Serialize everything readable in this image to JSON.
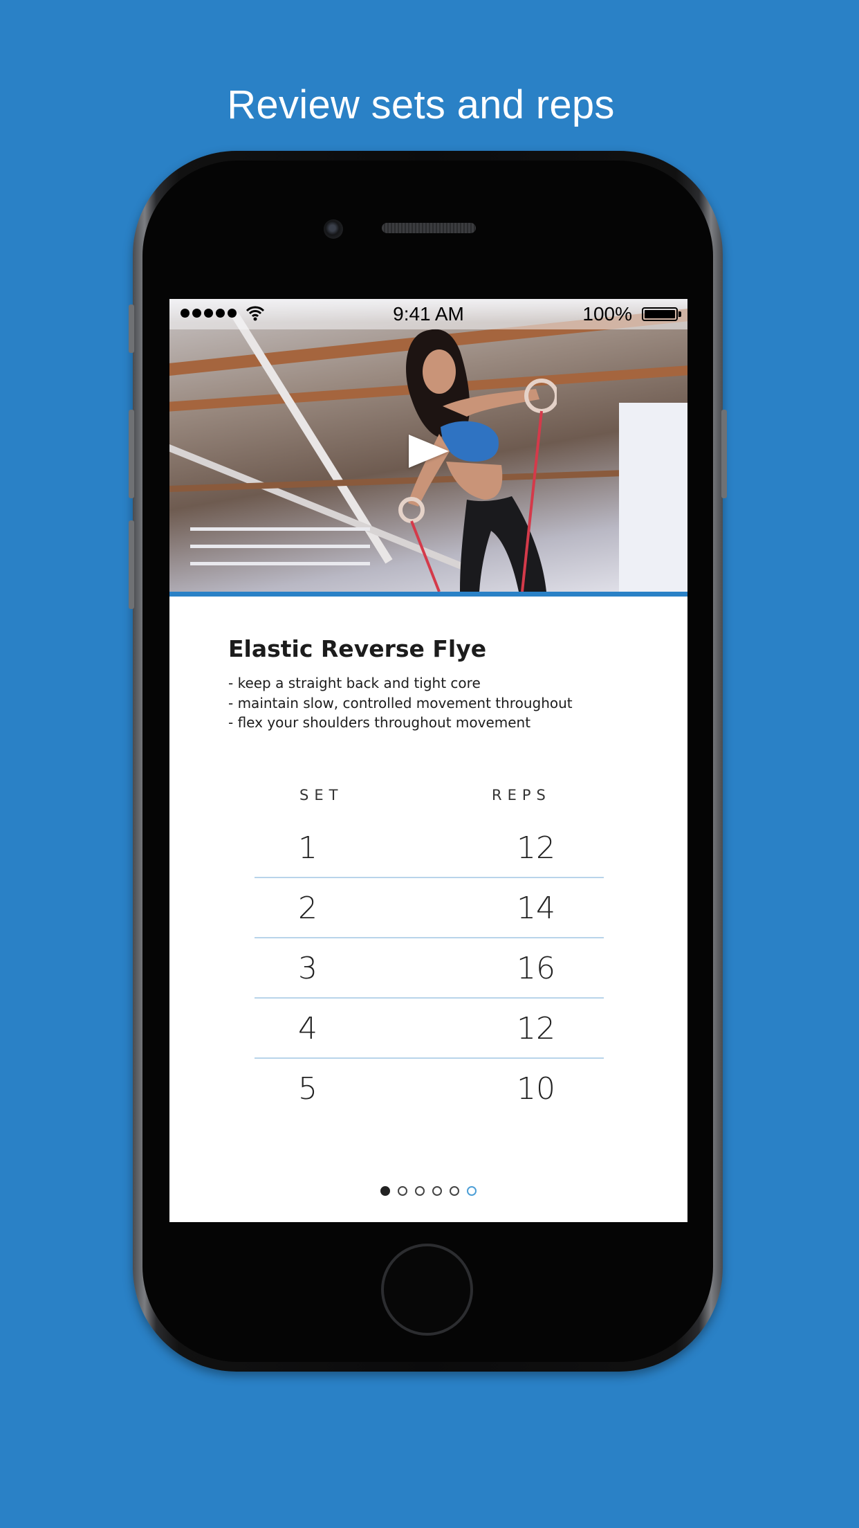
{
  "headline": "Review sets and reps",
  "status_bar": {
    "signal_dots": 5,
    "time": "9:41 AM",
    "battery": "100%",
    "battery_level": 1.0
  },
  "exercise": {
    "title": "Elastic Reverse Flye",
    "tips": [
      "- keep a straight back and tight core",
      "- maintain slow, controlled movement throughout",
      "- flex your shoulders throughout movement"
    ]
  },
  "table": {
    "headers": {
      "set": "SET",
      "reps": "REPS"
    },
    "rows": [
      {
        "set": "1",
        "reps": "12"
      },
      {
        "set": "2",
        "reps": "14"
      },
      {
        "set": "3",
        "reps": "16"
      },
      {
        "set": "4",
        "reps": "12"
      },
      {
        "set": "5",
        "reps": "10"
      }
    ]
  },
  "pager": {
    "count": 6,
    "active_index": 0
  },
  "colors": {
    "background": "#2a81c6",
    "accent": "#2a81c6",
    "divider": "#b8d4ea"
  }
}
